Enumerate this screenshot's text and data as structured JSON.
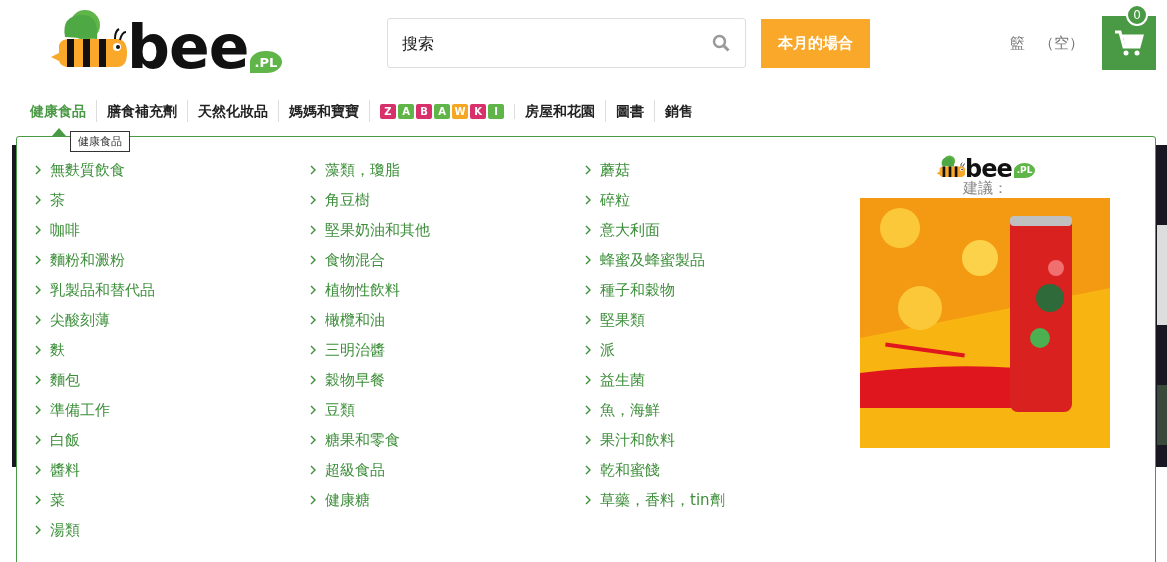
{
  "logo": {
    "text": "bee",
    "badge": ".PL"
  },
  "search": {
    "placeholder": "搜索"
  },
  "promo_button": "本月的場合",
  "basket": {
    "label": "籃",
    "status": "（空）",
    "count": "0"
  },
  "nav": [
    {
      "kind": "text",
      "label": "健康食品",
      "selected": true
    },
    {
      "kind": "text",
      "label": "膳食補充劑",
      "selected": false
    },
    {
      "kind": "text",
      "label": "天然化妝品",
      "selected": false
    },
    {
      "kind": "text",
      "label": "媽媽和寶寶",
      "selected": false
    },
    {
      "kind": "blocks",
      "letters": [
        {
          "char": "Z",
          "color": "#d8306a"
        },
        {
          "char": "A",
          "color": "#5fb548"
        },
        {
          "char": "B",
          "color": "#d8306a"
        },
        {
          "char": "A",
          "color": "#5fb548"
        },
        {
          "char": "W",
          "color": "#f5a623"
        },
        {
          "char": "K",
          "color": "#d8306a"
        },
        {
          "char": "I",
          "color": "#5fb548"
        }
      ],
      "selected": false
    },
    {
      "kind": "text",
      "label": "房屋和花園",
      "selected": false
    },
    {
      "kind": "text",
      "label": "圖書",
      "selected": false
    },
    {
      "kind": "text",
      "label": "銷售",
      "selected": false
    }
  ],
  "tooltip": "健康食品",
  "menu_columns": [
    [
      "無麩質飲食",
      "茶",
      "咖啡",
      "麵粉和澱粉",
      "乳製品和替代品",
      "尖酸刻薄",
      "麩",
      "麵包",
      "準備工作",
      "白飯",
      "醬料",
      "菜",
      "湯類"
    ],
    [
      "藻類，瓊脂",
      "角豆樹",
      "堅果奶油和其他",
      "食物混合",
      "植物性飲料",
      "橄欖和油",
      "三明治醬",
      "穀物早餐",
      "豆類",
      "糖果和零食",
      "超級食品",
      "健康糖"
    ],
    [
      "蘑菇",
      "碎粒",
      "意大利面",
      "蜂蜜及蜂蜜製品",
      "種子和穀物",
      "堅果類",
      "派",
      "益生菌",
      "魚，海鮮",
      "果汁和飲料",
      "乾和蜜餞",
      "草藥，香料，tin劑"
    ]
  ],
  "suggestion": {
    "logo_text": "bee",
    "logo_badge": ".PL",
    "label": "建議："
  }
}
